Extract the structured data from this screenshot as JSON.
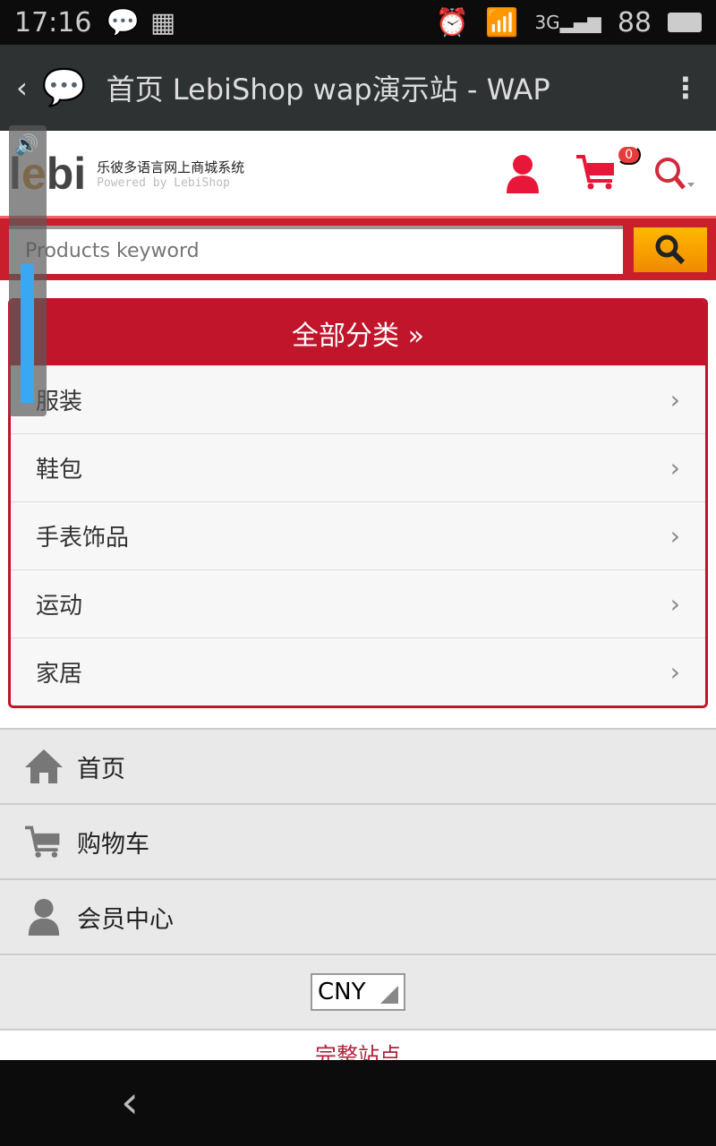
{
  "status": {
    "time": "17:16",
    "battery": "88"
  },
  "appbar": {
    "title": "首页 LebiShop wap演示站 - WAP"
  },
  "header": {
    "logo": "lebi",
    "slogan_cn": "乐彼多语言网上商城系统",
    "slogan_en": "Powered by LebiShop",
    "cart_count": "0"
  },
  "search": {
    "placeholder": "Products keyword"
  },
  "categories": {
    "title": "全部分类 »",
    "items": [
      "服装",
      "鞋包",
      "手表饰品",
      "运动",
      "家居"
    ]
  },
  "nav": {
    "items": [
      "首页",
      "购物车",
      "会员中心"
    ]
  },
  "currency": {
    "selected": "CNY"
  },
  "footer": {
    "full_site": "完整站点"
  },
  "volume": {
    "level_percent": 50
  },
  "colors": {
    "brand_red": "#c0152a",
    "search_button": "#f5a000"
  }
}
